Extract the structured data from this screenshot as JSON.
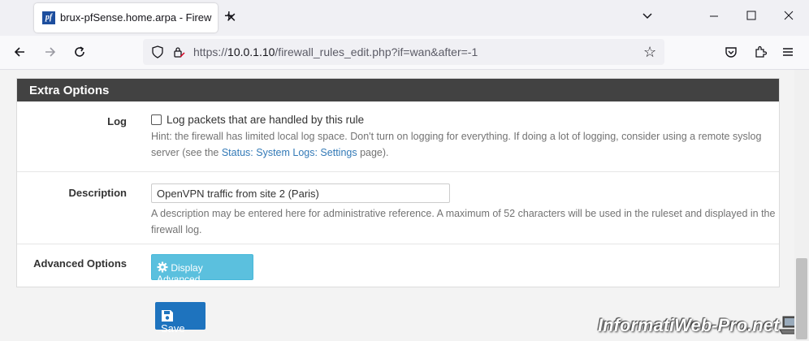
{
  "browser": {
    "tab_title": "brux-pfSense.home.arpa - Firew",
    "favicon_text": "pf",
    "url_prefix": "https://",
    "url_host": "10.0.1.10",
    "url_path": "/firewall_rules_edit.php?if=wan&after=-1"
  },
  "panel": {
    "heading": "Extra Options"
  },
  "log": {
    "label": "Log",
    "checkbox_label": "Log packets that are handled by this rule",
    "checked": false,
    "hint_before": "Hint: the firewall has limited local log space. Don't turn on logging for everything. If doing a lot of logging, consider using a remote syslog server (see the ",
    "hint_link": "Status: System Logs: Settings",
    "hint_after": " page)."
  },
  "description": {
    "label": "Description",
    "value": "OpenVPN traffic from site 2 (Paris)",
    "hint": "A description may be entered here for administrative reference. A maximum of 52 characters will be used in the ruleset and displayed in the firewall log."
  },
  "advanced": {
    "label": "Advanced Options",
    "button_label": "Display Advanced"
  },
  "save": {
    "button_label": "Save"
  },
  "watermark": {
    "text": "InformatiWeb-Pro.net"
  },
  "colors": {
    "heading_bg": "#424242",
    "info_button": "#5bc0de",
    "primary_button": "#1e73be",
    "link": "#337ab7"
  }
}
